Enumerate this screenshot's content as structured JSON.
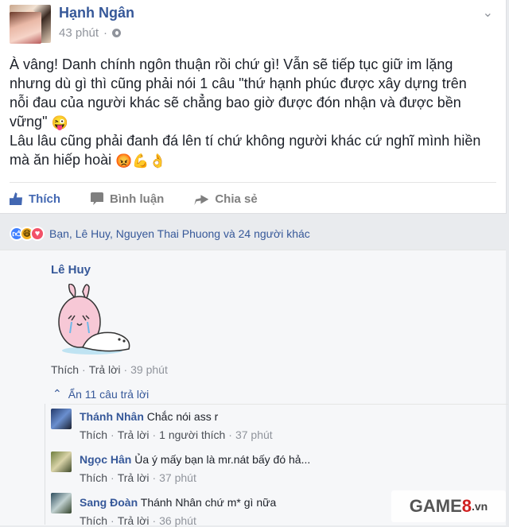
{
  "post": {
    "author": "Hạnh Ngân",
    "time": "43 phút",
    "text": "À vâng! Danh chính ngôn thuận rồi chứ gì! Vẫn sẽ tiếp tục giữ im lặng\nnhưng dù gì thì cũng phải nói 1 câu \"thứ hạnh phúc được xây dựng trên\nnỗi đau của người khác sẽ chẳng bao giờ được đón nhận và được bền\nvững\"",
    "text2": "Lâu lâu cũng phải đanh đá lên tí chứ không người khác cứ nghĩ mình hiền\nmà ăn hiếp hoài",
    "emoji_after_text": "😜",
    "emoji_after_text2": "😡💪👌"
  },
  "actions": {
    "like": "Thích",
    "comment": "Bình luận",
    "share": "Chia sẻ"
  },
  "reactions": {
    "summary": "Bạn, Lê Huy, Nguyen Thai Phuong và 24 người khác"
  },
  "comments": {
    "c1": {
      "author": "Lê Huy",
      "like": "Thích",
      "reply": "Trả lời",
      "time": "39 phút"
    },
    "hide_replies": "Ẩn 11 câu trả lời",
    "replies": [
      {
        "author": "Thánh Nhân",
        "text": "Chắc nói ass r",
        "like": "Thích",
        "reply": "Trả lời",
        "likes": "1 người thích",
        "time": "37 phút"
      },
      {
        "author": "Ngọc Hân",
        "text": "Ủa ý mấy bạn là mr.nát bấy đó hả...",
        "like": "Thích",
        "reply": "Trả lời",
        "time": "37 phút"
      },
      {
        "author": "Sang Đoàn",
        "text": "Thánh Nhân chứ m* gì nữa",
        "like": "Thích",
        "reply": "Trả lời",
        "time": "36 phút"
      }
    ]
  },
  "watermark": {
    "part1": "GAME",
    "part2": "8",
    "part3": ".vn"
  },
  "colors": {
    "link": "#365899",
    "like_blue": "#4267b2",
    "meta_gray": "#90949c"
  }
}
